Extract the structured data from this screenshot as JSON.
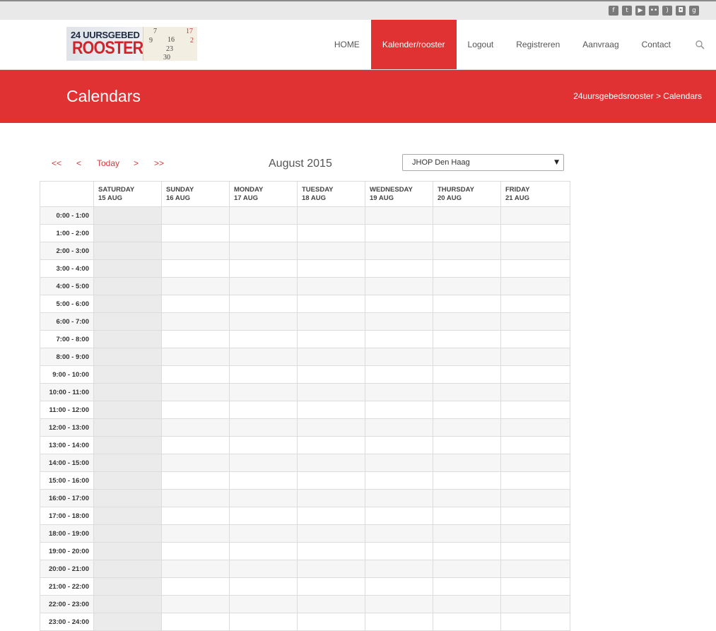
{
  "social_icons": [
    "facebook-icon",
    "twitter-icon",
    "youtube-icon",
    "flickr-icon",
    "rss-icon",
    "instagram-icon",
    "googleplus-icon"
  ],
  "logo": {
    "line1": "24 UURSGEBED",
    "line2": "ROOSTER",
    "cal_numbers": [
      "7",
      "17",
      "9",
      "16",
      "2",
      "23",
      "30"
    ]
  },
  "nav": {
    "items": [
      {
        "label": "HOME"
      },
      {
        "label": "Kalender/rooster",
        "active": true
      },
      {
        "label": "Logout"
      },
      {
        "label": "Registreren"
      },
      {
        "label": "Aanvraag"
      },
      {
        "label": "Contact"
      }
    ]
  },
  "banner": {
    "title": "Calendars",
    "breadcrumb": {
      "home": "24uursgebedsrooster",
      "sep": " > ",
      "current": "Calendars"
    }
  },
  "controls": {
    "first": "<<",
    "prev": "<",
    "today": "Today",
    "next": ">",
    "last": ">>",
    "month_label": "August 2015",
    "location_selected": "JHOP Den Haag"
  },
  "days": [
    {
      "name": "SATURDAY",
      "date": "15 AUG"
    },
    {
      "name": "SUNDAY",
      "date": "16 AUG"
    },
    {
      "name": "MONDAY",
      "date": "17 AUG"
    },
    {
      "name": "TUESDAY",
      "date": "18 AUG"
    },
    {
      "name": "WEDNESDAY",
      "date": "19 AUG"
    },
    {
      "name": "THURSDAY",
      "date": "20 AUG"
    },
    {
      "name": "FRIDAY",
      "date": "21 AUG"
    }
  ],
  "timeslots": [
    "0:00 - 1:00",
    "1:00 - 2:00",
    "2:00 - 3:00",
    "3:00 - 4:00",
    "4:00 - 5:00",
    "5:00 - 6:00",
    "6:00 - 7:00",
    "7:00 - 8:00",
    "8:00 - 9:00",
    "9:00 - 10:00",
    "10:00 - 11:00",
    "11:00 - 12:00",
    "12:00 - 13:00",
    "13:00 - 14:00",
    "14:00 - 15:00",
    "15:00 - 16:00",
    "16:00 - 17:00",
    "17:00 - 18:00",
    "18:00 - 19:00",
    "19:00 - 20:00",
    "20:00 - 21:00",
    "21:00 - 22:00",
    "22:00 - 23:00",
    "23:00 - 24:00"
  ],
  "colors": {
    "accent": "#e03232"
  }
}
